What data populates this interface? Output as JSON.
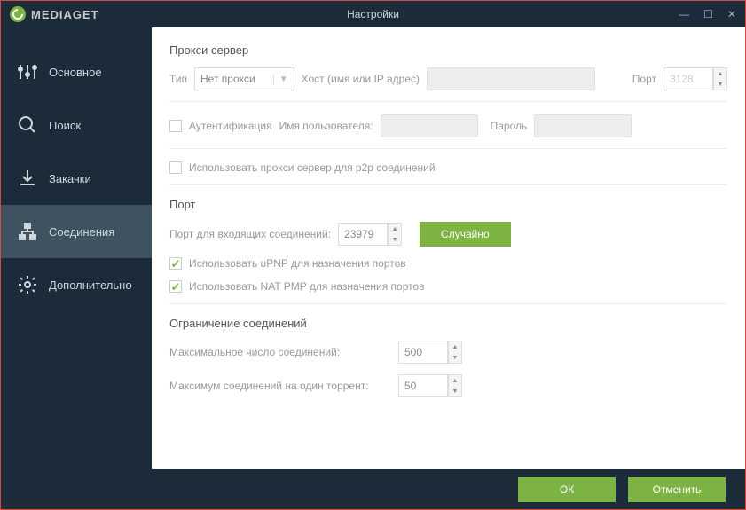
{
  "brand": "MEDIAGET",
  "window_title": "Настройки",
  "sidebar": {
    "items": [
      {
        "label": "Основное"
      },
      {
        "label": "Поиск"
      },
      {
        "label": "Закачки"
      },
      {
        "label": "Соединения"
      },
      {
        "label": "Дополнительно"
      }
    ]
  },
  "proxy": {
    "section_title": "Прокси сервер",
    "type_label": "Тип",
    "type_value": "Нет прокси",
    "host_label": "Хост (имя или IP адрес)",
    "port_label": "Порт",
    "port_value": "3128",
    "auth_label": "Аутентификация",
    "user_label": "Имя пользователя:",
    "pass_label": "Пароль",
    "p2p_label": "Использовать прокси сервер для p2p соединений"
  },
  "port": {
    "section_title": "Порт",
    "incoming_label": "Порт для входящих соединений:",
    "incoming_value": "23979",
    "random_btn": "Случайно",
    "upnp_label": "Использовать uPNP для назначения портов",
    "natpmp_label": "Использовать NAT PMP для назначения портов"
  },
  "limits": {
    "section_title": "Ограничение соединений",
    "max_conn_label": "Максимальное число соединений:",
    "max_conn_value": "500",
    "per_torrent_label": "Максимум соединений на один торрент:",
    "per_torrent_value": "50"
  },
  "footer": {
    "ok": "ОК",
    "cancel": "Отменить"
  }
}
